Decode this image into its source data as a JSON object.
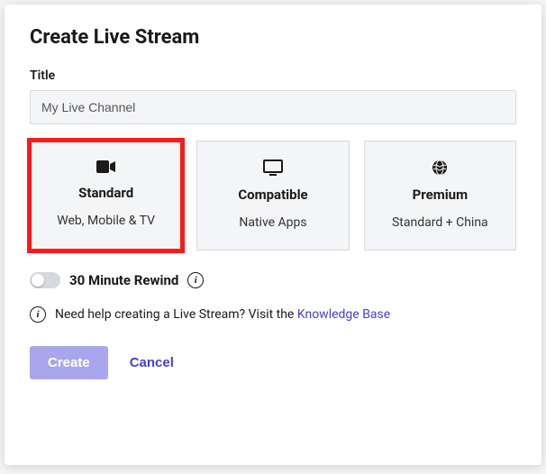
{
  "header": {
    "title": "Create Live Stream"
  },
  "form": {
    "title_label": "Title",
    "title_value": "My Live Channel"
  },
  "plans": [
    {
      "icon": "video-camera",
      "title": "Standard",
      "sub": "Web, Mobile & TV",
      "highlighted": true
    },
    {
      "icon": "monitor",
      "title": "Compatible",
      "sub": "Native Apps",
      "highlighted": false
    },
    {
      "icon": "globe",
      "title": "Premium",
      "sub": "Standard + China",
      "highlighted": false
    }
  ],
  "rewind": {
    "enabled": false,
    "label": "30 Minute Rewind"
  },
  "help": {
    "text_prefix": "Need help creating a Live Stream? Visit the ",
    "link_text": "Knowledge Base"
  },
  "actions": {
    "create": "Create",
    "cancel": "Cancel"
  }
}
